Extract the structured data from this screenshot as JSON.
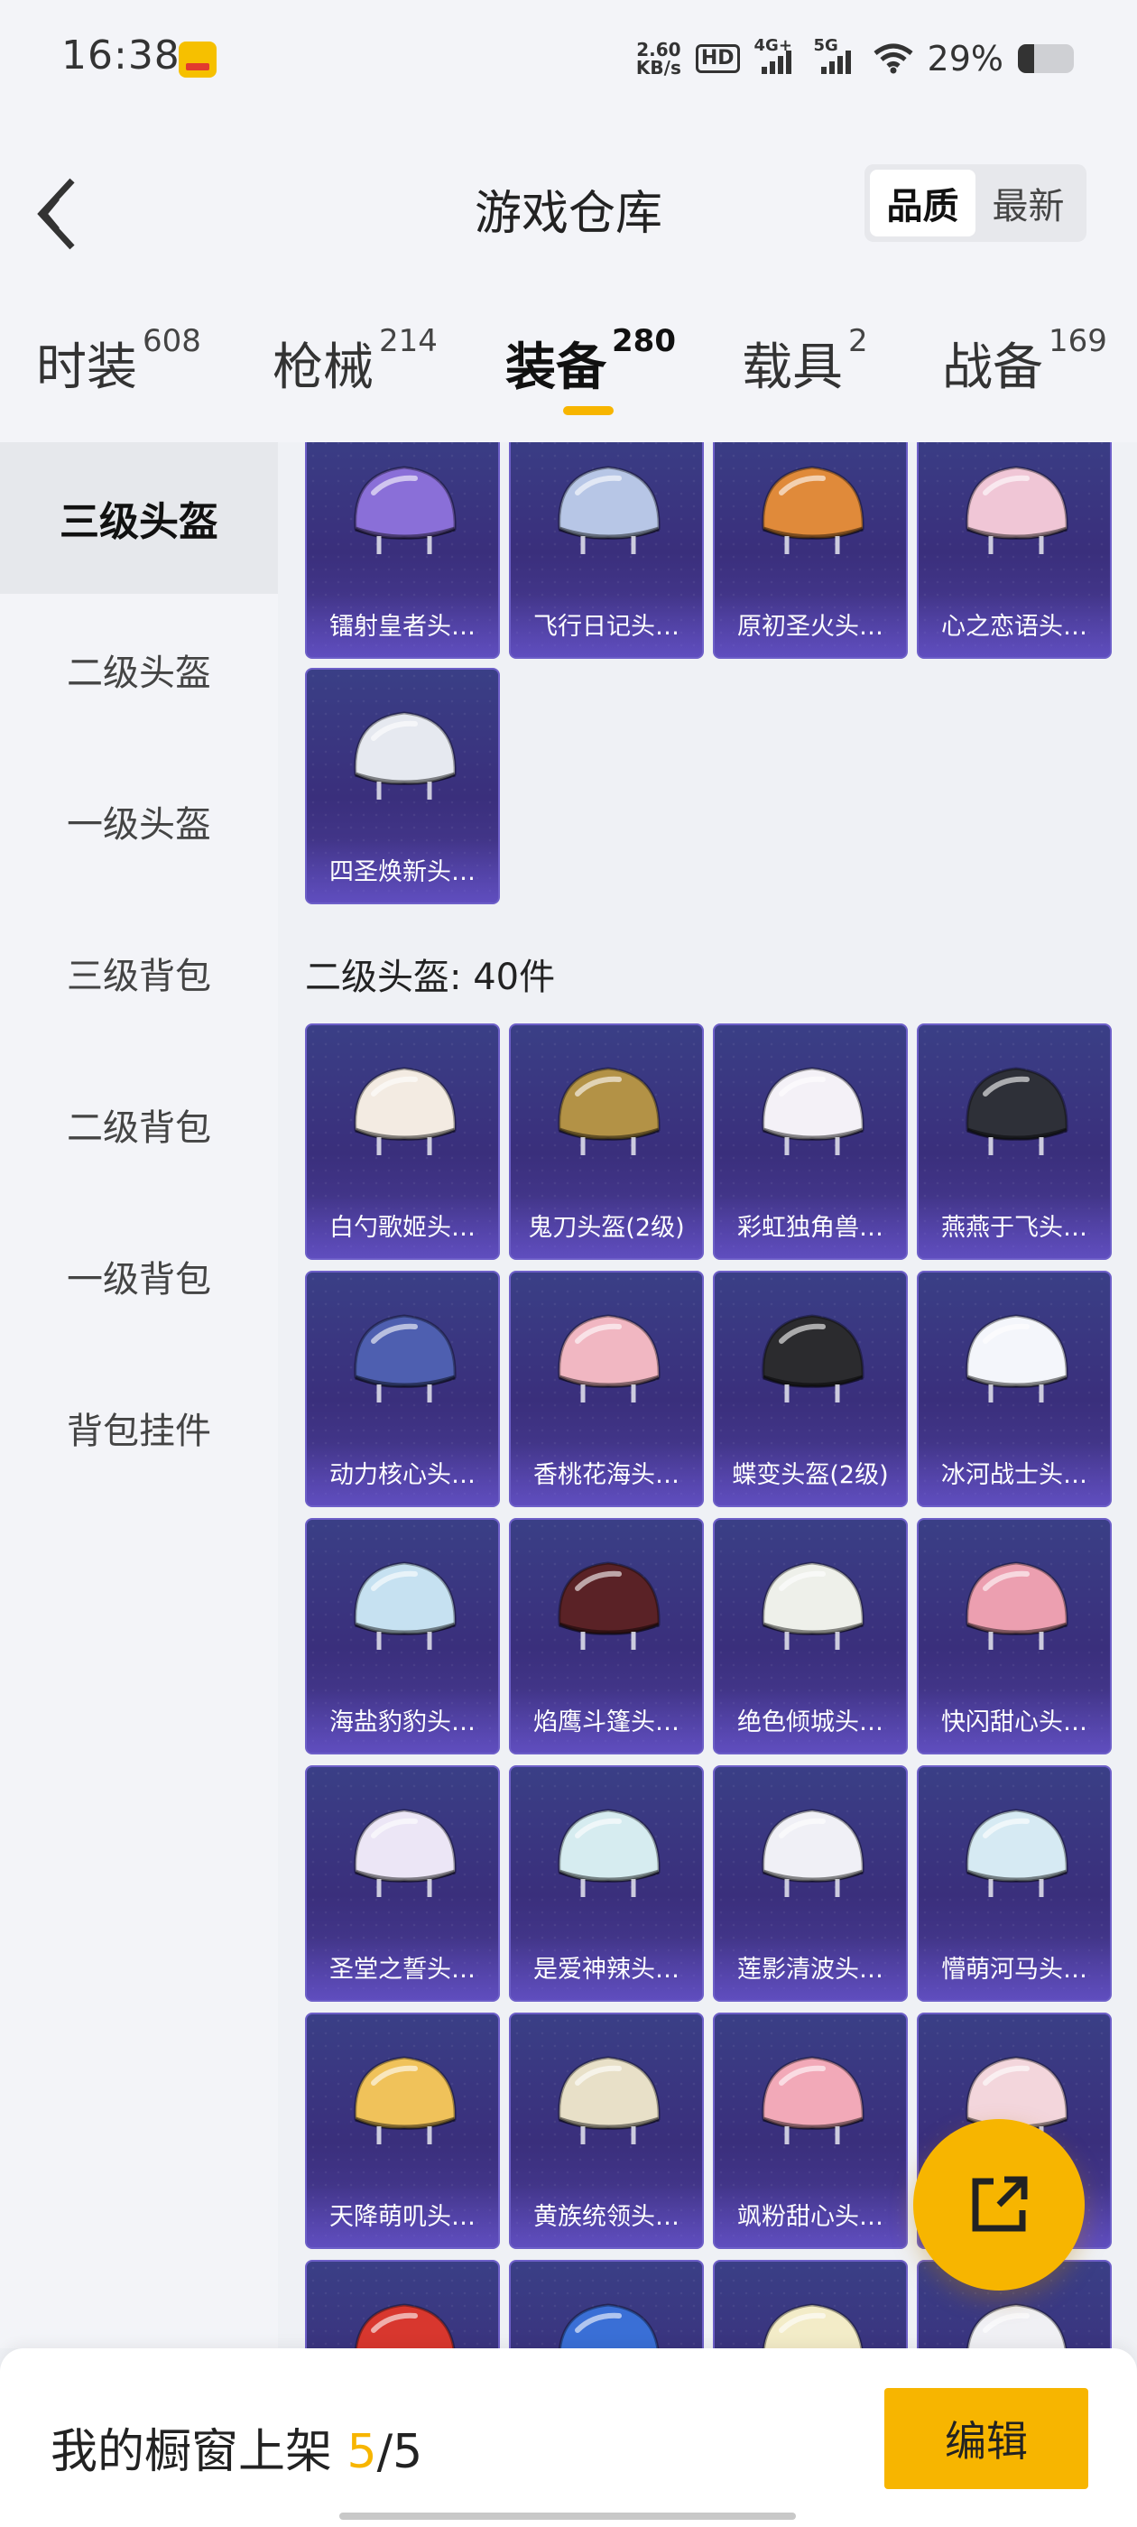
{
  "status": {
    "time": "16:38",
    "net_speed_value": "2.60",
    "net_speed_unit": "KB/s",
    "hd_label": "HD",
    "sig1_label": "4G+",
    "sig2_label": "5G",
    "battery_text": "29%",
    "battery_level": 0.29
  },
  "header": {
    "title": "游戏仓库",
    "sort_quality": "品质",
    "sort_newest": "最新"
  },
  "tabs": [
    {
      "label": "时装",
      "count": "608"
    },
    {
      "label": "枪械",
      "count": "214"
    },
    {
      "label": "装备",
      "count": "280"
    },
    {
      "label": "载具",
      "count": "2"
    },
    {
      "label": "战备",
      "count": "169"
    }
  ],
  "sidebar": [
    {
      "label": "三级头盔"
    },
    {
      "label": "二级头盔"
    },
    {
      "label": "一级头盔"
    },
    {
      "label": "三级背包"
    },
    {
      "label": "二级背包"
    },
    {
      "label": "一级背包"
    },
    {
      "label": "背包挂件"
    }
  ],
  "section": {
    "label": "二级头盔: 40件"
  },
  "items": [
    {
      "name": "镭射皇者头…",
      "color": "#8a6fd8"
    },
    {
      "name": "飞行日记头…",
      "color": "#b7c6e6"
    },
    {
      "name": "原初圣火头…",
      "color": "#e08a3a"
    },
    {
      "name": "心之恋语头…",
      "color": "#f0c6d6"
    },
    {
      "name": "四圣焕新头…",
      "color": "#e6e9f0"
    },
    {
      "name": "白勺歌姬头…",
      "color": "#f3ebe2"
    },
    {
      "name": "鬼刀头盔(2级)",
      "color": "#b39246"
    },
    {
      "name": "彩虹独角兽…",
      "color": "#f4f1f7"
    },
    {
      "name": "燕燕于飞头…",
      "color": "#2e3038"
    },
    {
      "name": "动力核心头…",
      "color": "#4e5fb0"
    },
    {
      "name": "香桃花海头…",
      "color": "#f1b7c2"
    },
    {
      "name": "蝶变头盔(2级)",
      "color": "#2b2b2e"
    },
    {
      "name": "冰河战士头…",
      "color": "#f4f6fb"
    },
    {
      "name": "海盐豹豹头…",
      "color": "#c6e1f1"
    },
    {
      "name": "焰鹰斗篷头…",
      "color": "#5a2226"
    },
    {
      "name": "绝色倾城头…",
      "color": "#eef0ea"
    },
    {
      "name": "快闪甜心头…",
      "color": "#ec9fb0"
    },
    {
      "name": "圣堂之誓头…",
      "color": "#ece6f6"
    },
    {
      "name": "是爱神辣头…",
      "color": "#d6ecf0"
    },
    {
      "name": "莲影清波头…",
      "color": "#f0f0f6"
    },
    {
      "name": "懵萌河马头…",
      "color": "#d6eaf3"
    },
    {
      "name": "天降萌叽头…",
      "color": "#f0c25a"
    },
    {
      "name": "黄族统领头…",
      "color": "#e8e0c8"
    },
    {
      "name": "飒粉甜心头…",
      "color": "#f2a9b8"
    },
    {
      "name": "",
      "color": "#f3d6dc"
    },
    {
      "name": "",
      "color": "#d8372e"
    },
    {
      "name": "",
      "color": "#3a6fd6"
    },
    {
      "name": "",
      "color": "#f3ecc8"
    },
    {
      "name": "",
      "color": "#f0f0f4"
    }
  ],
  "bottom": {
    "label": "我的橱窗上架",
    "current": "5",
    "total": "/5",
    "edit_label": "编辑"
  }
}
